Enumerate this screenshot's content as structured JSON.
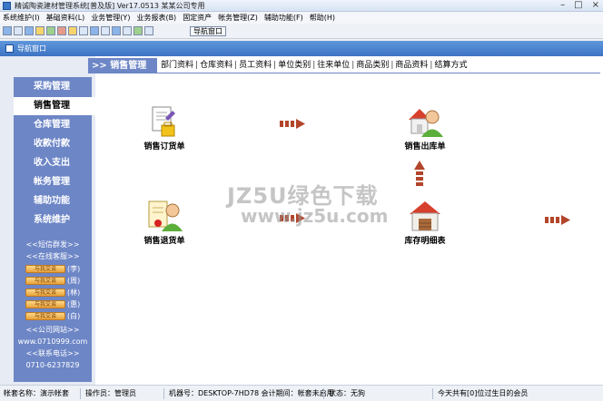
{
  "window": {
    "title": "精诚陶瓷建材管理系统[普及版] Ver17.0513   某某公司专用"
  },
  "menu": [
    "系统维护(I)",
    "基础资料(L)",
    "业务管理(Y)",
    "业务报表(B)",
    "固定资产",
    "帐务管理(Z)",
    "辅助功能(F)",
    "帮助(H)"
  ],
  "toolbar": {
    "nav_button": "导航窗口"
  },
  "panel": {
    "title": "导航窗口"
  },
  "sidebar": {
    "items": [
      "采购管理",
      "销售管理",
      "仓库管理",
      "收款付款",
      "收入支出",
      "帐务管理",
      "辅助功能",
      "系统维护"
    ],
    "active_index": 1,
    "sms": "<<短信群发>>",
    "support": "<<在线客服>>",
    "qq_button": "与我交谈",
    "qq_names": [
      "(李)",
      "(周)",
      "(林)",
      "(惠)",
      "(白)"
    ],
    "website_label": "<<公司网站>>",
    "website": "www.0710999.com",
    "phone_label": "<<联系电话>>",
    "phone": "0710-6237829"
  },
  "tabs": {
    "active": ">> 销售管理",
    "links": [
      "部门资料",
      "仓库资料",
      "员工资料",
      "单位类别",
      "往来单位",
      "商品类别",
      "商品资料",
      "结算方式"
    ]
  },
  "docs": {
    "sales_order": "销售订货单",
    "sales_out": "销售出库单",
    "sales_return": "销售退货单",
    "inventory": "库存明细表"
  },
  "watermark": {
    "line1": "JZ5U绿色下载",
    "line2": "www.jz5u.com"
  },
  "status": {
    "account": "帐套名称：演示帐套",
    "operator": "操作员：管理员",
    "machine": "机器号：DESKTOP-7HD78  会计期间：帐套未启用",
    "state": "状态：无狗",
    "birthday": "今天共有[0]位过生日的会员"
  },
  "colors": {
    "accent": "#6d86c6",
    "header": "#3d73c2",
    "arrow": "#b3452b"
  }
}
